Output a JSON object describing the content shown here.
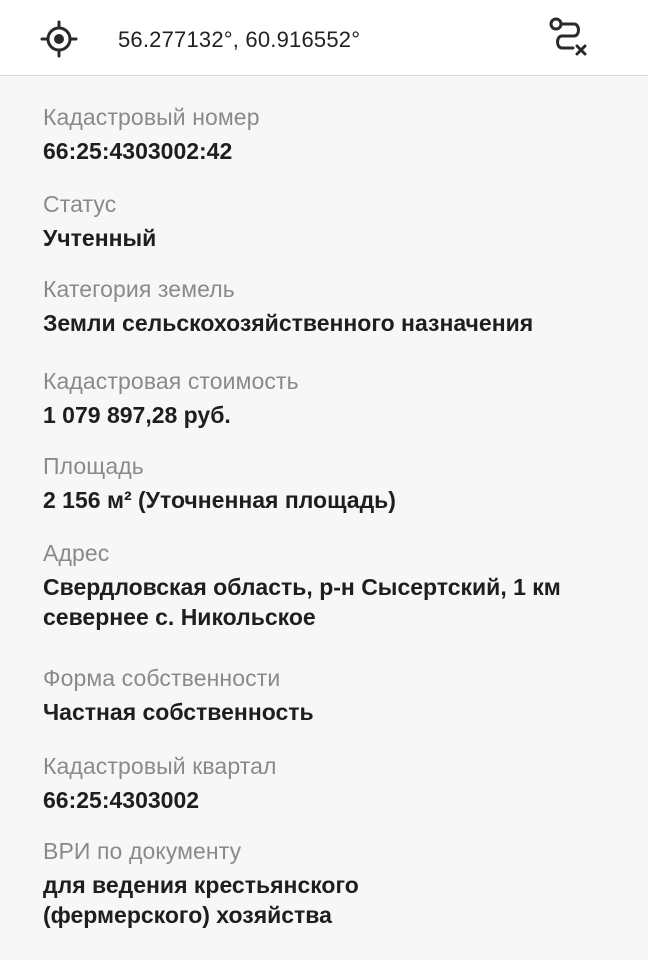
{
  "header": {
    "coordinates": "56.277132°, 60.916552°",
    "locate_icon": "crosshair-target-icon",
    "route_icon": "route-clear-icon"
  },
  "fields": [
    {
      "label": "Кадастровый номер",
      "value": "66:25:4303002:42"
    },
    {
      "label": "Статус",
      "value": "Учтенный"
    },
    {
      "label": "Категория земель",
      "value": "Земли сельскохозяйственного назначения"
    },
    {
      "label": "Кадастровая стоимость",
      "value": "1 079 897,28 руб."
    },
    {
      "label": "Площадь",
      "value": "2 156 м² (Уточненная площадь)"
    },
    {
      "label": "Адрес",
      "value": "Свердловская область, р-н Сысертский, 1 км севернее с. Никольское"
    },
    {
      "label": "Форма собственности",
      "value": "Частная собственность"
    },
    {
      "label": "Кадастровый квартал",
      "value": "66:25:4303002"
    },
    {
      "label": "ВРИ по документу",
      "value": "для ведения крестьянского (фермерского) хозяйства"
    }
  ],
  "colors": {
    "label": "#8a8a8a",
    "value": "#1e1e1e",
    "background": "#f7f7f7",
    "header_background": "#ffffff"
  }
}
